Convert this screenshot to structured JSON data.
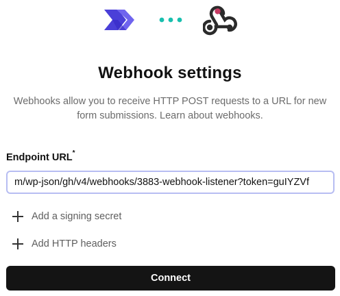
{
  "header": {
    "app_logo_icon": "chevron-arrows-logo-icon",
    "connector_icon": "ellipsis-dots-icon",
    "webhook_logo_icon": "webhook-icon",
    "accent_color": "#4a3fd8",
    "dots_color": "#19bfae",
    "webhook_color": "#2b2b2b",
    "webhook_accent": "#c73a63"
  },
  "title": "Webhook settings",
  "description": "Webhooks allow you to receive HTTP POST requests to a URL for new form submissions. Learn about webhooks.",
  "endpoint": {
    "label": "Endpoint URL",
    "required_mark": "*",
    "value": "m/wp-json/gh/v4/webhooks/3883-webhook-listener?token=guIYZVf"
  },
  "actions": {
    "signing_secret": "Add a signing secret",
    "http_headers": "Add HTTP headers"
  },
  "connect_button": "Connect"
}
